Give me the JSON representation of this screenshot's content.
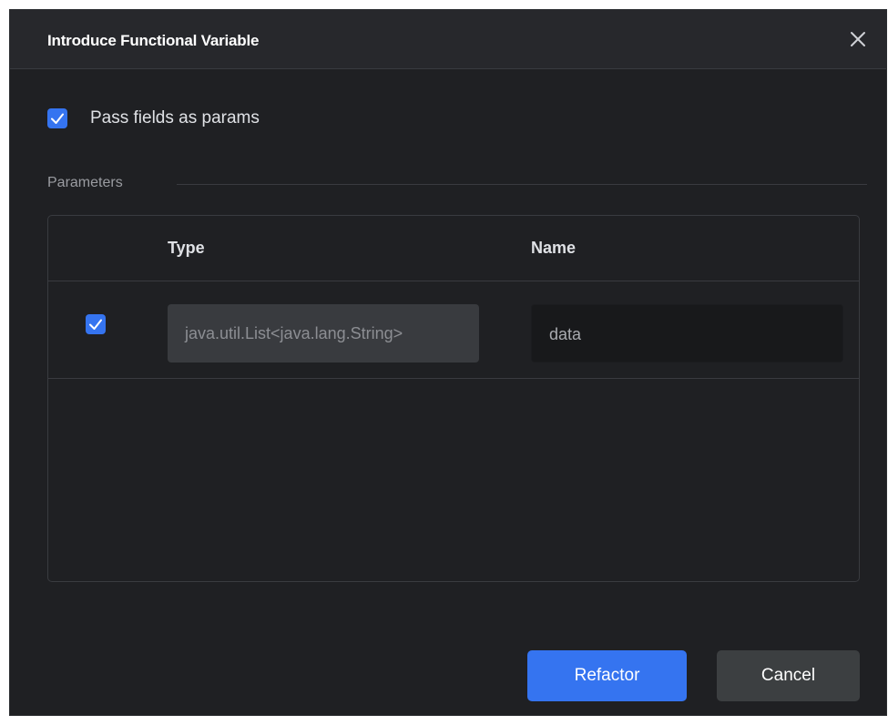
{
  "dialog": {
    "title": "Introduce Functional Variable",
    "close_icon": "close-icon"
  },
  "options": {
    "pass_fields_label": "Pass fields as params",
    "pass_fields_checked": true
  },
  "parameters": {
    "section_label": "Parameters",
    "columns": [
      "Type",
      "Name"
    ],
    "rows": [
      {
        "checked": true,
        "type": "java.util.List<java.lang.String>",
        "name": "data"
      }
    ]
  },
  "buttons": {
    "refactor_label": "Refactor",
    "cancel_label": "Cancel"
  },
  "colors": {
    "accent": "#3574f0",
    "background": "#1f2023",
    "titlebar": "#27282c"
  }
}
